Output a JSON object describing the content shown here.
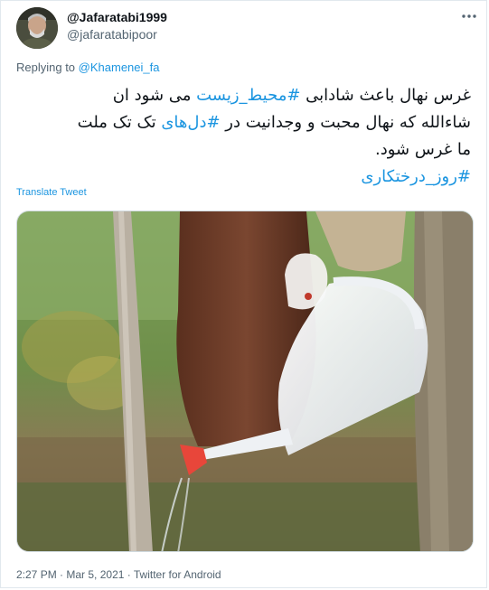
{
  "author": {
    "display_name": "@Jafaratabi1999",
    "handle": "@jafaratabipoor"
  },
  "more_icon": "more-horizontal-icon",
  "reply": {
    "prefix": "Replying to ",
    "target": "@Khamenei_fa"
  },
  "tweet": {
    "line1_a": "غرس نهال باعث شادابی ",
    "line1_tag": "#محیط_زیست",
    "line1_b": " می شود ان",
    "line2_a": "شاءالله که نهال محبت و وجدانیت در ",
    "line2_tag": "#دل‌های",
    "line2_b": " تک تک ملت",
    "line3": "ما غرس شود.",
    "line4_tag": "#روز_درختکاری"
  },
  "translate_label": "Translate Tweet",
  "meta": {
    "time": "2:27 PM",
    "separator": " · ",
    "date": "Mar 5, 2021",
    "client": "Twitter for Android"
  },
  "colors": {
    "link": "#1b95e0",
    "text": "#0f1419",
    "muted": "#536471"
  }
}
